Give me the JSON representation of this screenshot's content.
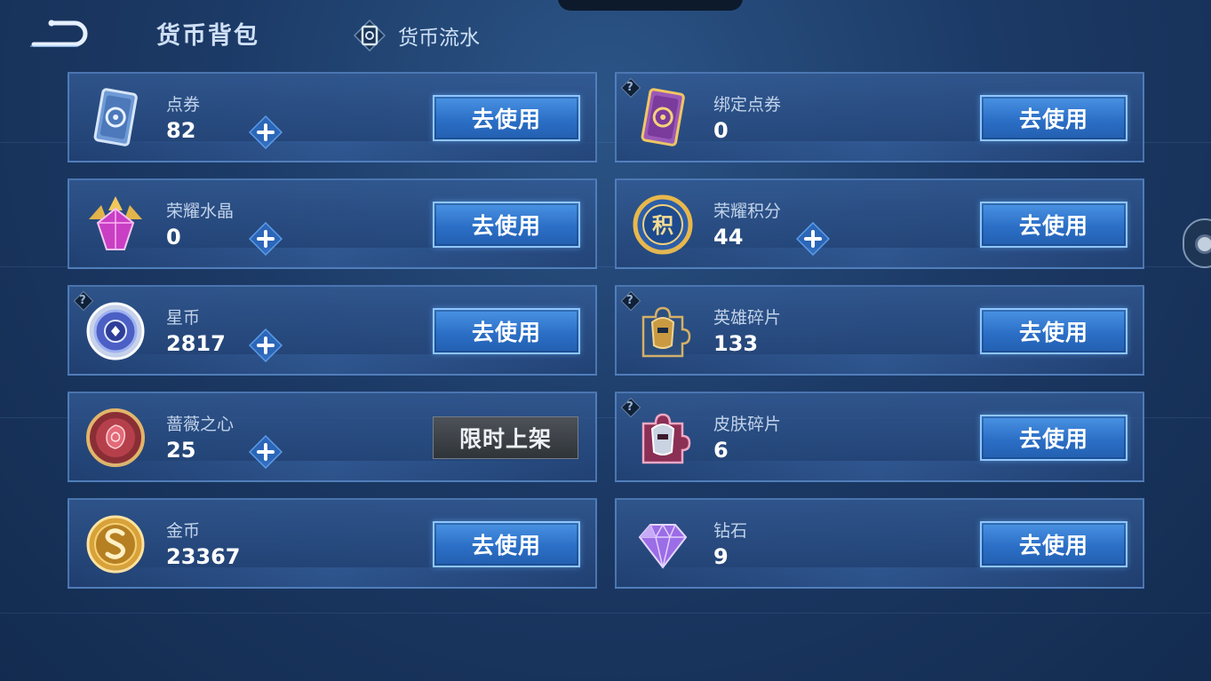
{
  "header": {
    "title": "货币背包",
    "flow_link": "货币流水"
  },
  "currencies": [
    {
      "name": "点券",
      "amount": "82",
      "action": "去使用",
      "plus": true,
      "help": false,
      "icon": "voucher-icon"
    },
    {
      "name": "绑定点券",
      "amount": "0",
      "action": "去使用",
      "plus": false,
      "help": true,
      "icon": "bound-voucher-icon"
    },
    {
      "name": "荣耀水晶",
      "amount": "0",
      "action": "去使用",
      "plus": true,
      "help": false,
      "icon": "glory-crystal-icon"
    },
    {
      "name": "荣耀积分",
      "amount": "44",
      "action": "去使用",
      "plus": true,
      "help": false,
      "icon": "glory-points-icon",
      "icon_glyph": "积"
    },
    {
      "name": "星币",
      "amount": "2817",
      "action": "去使用",
      "plus": true,
      "help": true,
      "icon": "star-coin-icon"
    },
    {
      "name": "英雄碎片",
      "amount": "133",
      "action": "去使用",
      "plus": false,
      "help": true,
      "icon": "hero-fragment-icon"
    },
    {
      "name": "蔷薇之心",
      "amount": "25",
      "action": "限时上架",
      "plus": true,
      "help": false,
      "icon": "rose-heart-icon"
    },
    {
      "name": "皮肤碎片",
      "amount": "6",
      "action": "去使用",
      "plus": false,
      "help": true,
      "icon": "skin-fragment-icon"
    },
    {
      "name": "金币",
      "amount": "23367",
      "action": "去使用",
      "plus": false,
      "help": false,
      "icon": "gold-coin-icon"
    },
    {
      "name": "钻石",
      "amount": "9",
      "action": "去使用",
      "plus": false,
      "help": false,
      "icon": "diamond-icon"
    }
  ],
  "help_glyph": "?",
  "colors": {
    "background": "#1c3a66",
    "button_blue": "#2b6fc6",
    "button_disabled": "#3a3f45",
    "plus_blue": "#3b7fd6"
  }
}
